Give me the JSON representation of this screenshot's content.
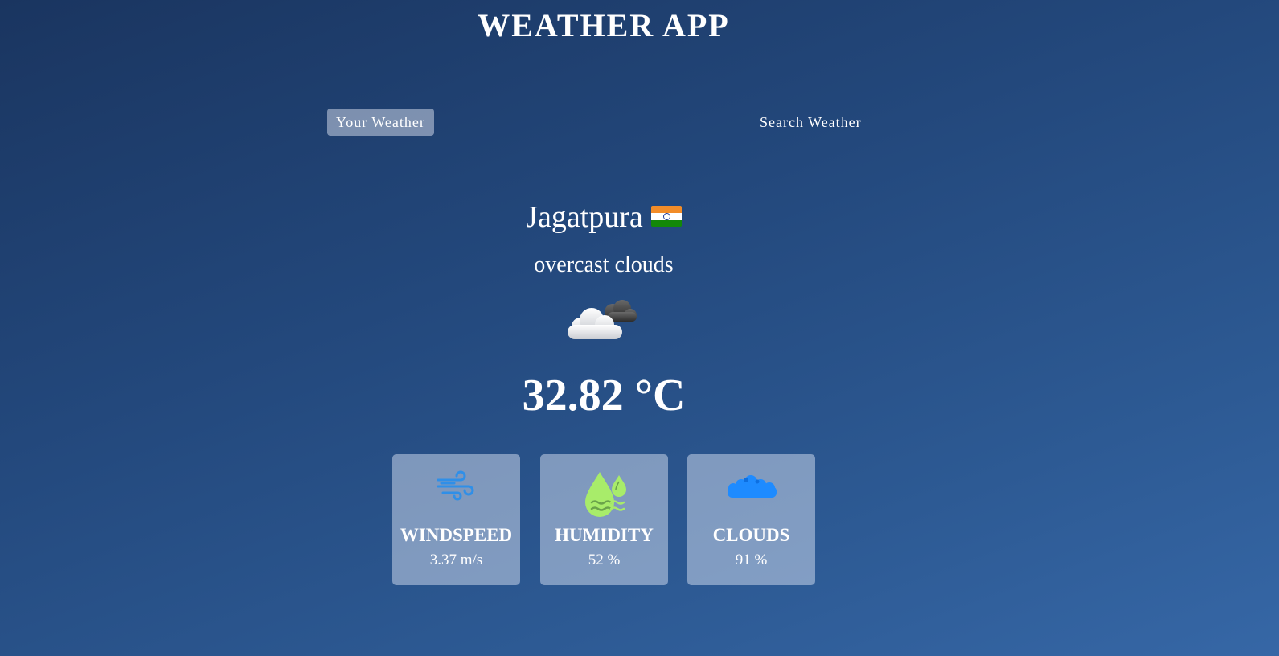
{
  "app": {
    "title": "WEATHER APP"
  },
  "tabs": [
    {
      "label": "Your Weather",
      "active": true
    },
    {
      "label": "Search Weather",
      "active": false
    }
  ],
  "location": {
    "city": "Jagatpura",
    "country_flag": "flag-india-icon"
  },
  "weather": {
    "description": "overcast clouds",
    "icon": "overcast-clouds-icon",
    "temperature": "32.82 °C"
  },
  "stats": [
    {
      "title": "WINDSPEED",
      "value": "3.37 m/s",
      "icon": "wind-icon",
      "color": "#2f8fe8"
    },
    {
      "title": "HUMIDITY",
      "value": "52 %",
      "icon": "humidity-drops-icon",
      "color": "#a8ec6a"
    },
    {
      "title": "CLOUDS",
      "value": "91 %",
      "icon": "clouds-icon",
      "color": "#1e8bff"
    }
  ],
  "colors": {
    "background_start": "#1a3560",
    "background_end": "#3667a6",
    "text": "#ffffff"
  }
}
